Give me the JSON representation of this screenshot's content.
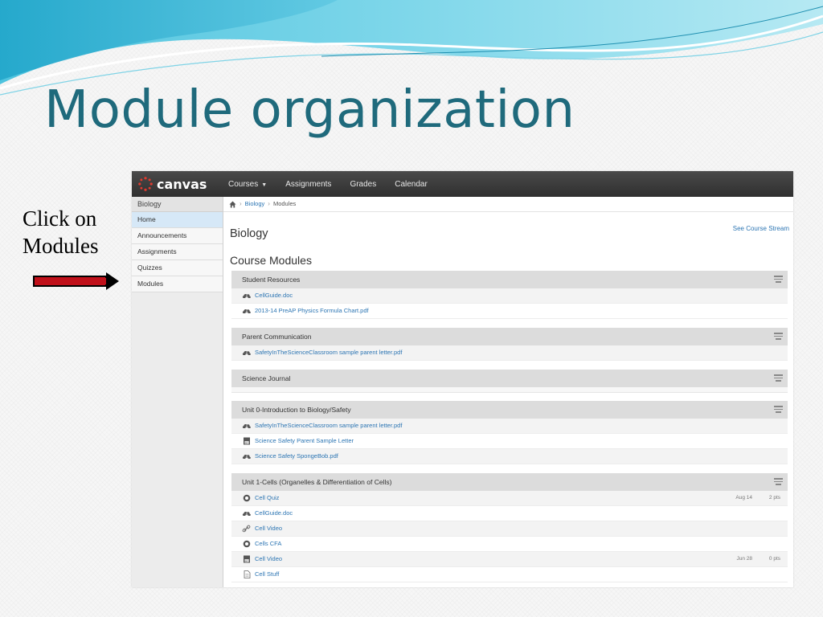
{
  "slide": {
    "title": "Module organization",
    "note_line1": "Click on",
    "note_line2": "Modules"
  },
  "colors": {
    "title": "#1f6a7c",
    "arrow": "#c0101a",
    "topbar": "#3b3b3b",
    "link": "#2c75b3"
  },
  "canvas": {
    "logo_text": "canvas",
    "nav": {
      "courses": "Courses",
      "assignments": "Assignments",
      "grades": "Grades",
      "calendar": "Calendar"
    },
    "sidebar": {
      "course": "Biology",
      "items": [
        "Home",
        "Announcements",
        "Assignments",
        "Quizzes",
        "Modules"
      ]
    },
    "breadcrumb": {
      "course": "Biology",
      "page": "Modules"
    },
    "stream_link": "See Course Stream",
    "course_name": "Biology",
    "modules_title": "Course Modules",
    "modules": [
      {
        "title": "Student Resources",
        "items": [
          {
            "icon": "attachment-icon",
            "name": "CellGuide.doc"
          },
          {
            "icon": "attachment-icon",
            "name": "2013-14 PreAP Physics Formula Chart.pdf"
          }
        ]
      },
      {
        "title": "Parent Communication",
        "items": [
          {
            "icon": "attachment-icon",
            "name": "SafetyInTheScienceClassroom sample parent letter.pdf"
          }
        ]
      },
      {
        "title": "Science Journal",
        "items": []
      },
      {
        "title": "Unit 0-Introduction to Biology/Safety",
        "items": [
          {
            "icon": "attachment-icon",
            "name": "SafetyInTheScienceClassroom sample parent letter.pdf"
          },
          {
            "icon": "assignment-icon",
            "name": "Science Safety Parent Sample Letter"
          },
          {
            "icon": "attachment-icon",
            "name": "Science Safety SpongeBob.pdf"
          }
        ]
      },
      {
        "title": "Unit 1-Cells (Organelles & Differentiation of Cells)",
        "items": [
          {
            "icon": "quiz-icon",
            "name": "Cell Quiz",
            "date": "Aug 14",
            "pts": "2 pts"
          },
          {
            "icon": "attachment-icon",
            "name": "CellGuide.doc"
          },
          {
            "icon": "link-icon",
            "name": "Cell Video"
          },
          {
            "icon": "quiz-icon",
            "name": "Cells CFA"
          },
          {
            "icon": "assignment-icon",
            "name": "Cell Video",
            "date": "Jun 28",
            "pts": "0 pts"
          },
          {
            "icon": "page-icon",
            "name": "Cell Stuff"
          }
        ]
      }
    ]
  }
}
